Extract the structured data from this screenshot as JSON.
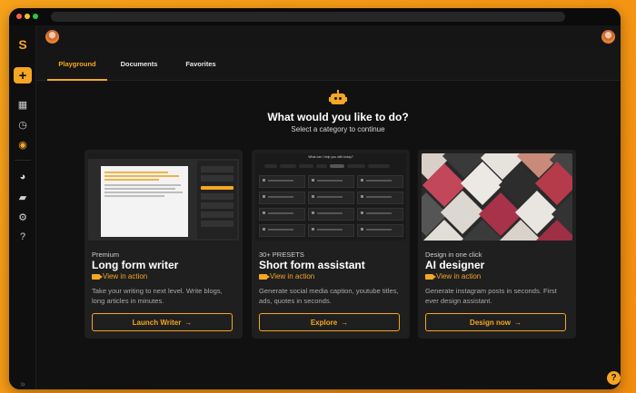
{
  "window": {
    "url_placeholder": ""
  },
  "sidebar": {
    "items": [
      {
        "icon": "logo-icon",
        "glyph": "S"
      },
      {
        "icon": "plus-icon",
        "glyph": "+"
      },
      {
        "icon": "grid-icon",
        "glyph": "▦"
      },
      {
        "icon": "clock-icon",
        "glyph": "◷"
      },
      {
        "icon": "eye-icon",
        "glyph": "◉"
      },
      {
        "icon": "palette-icon",
        "glyph": "◕"
      },
      {
        "icon": "folder-icon",
        "glyph": "▰"
      },
      {
        "icon": "gear-icon",
        "glyph": "⚙"
      },
      {
        "icon": "question-icon",
        "glyph": "?"
      },
      {
        "icon": "collapse-icon",
        "glyph": "»"
      }
    ]
  },
  "tabs": [
    {
      "label": "Playground",
      "active": true
    },
    {
      "label": "Documents",
      "active": false
    },
    {
      "label": "Favorites",
      "active": false
    }
  ],
  "main": {
    "heading": "What would you like to do?",
    "subheading": "Select a category to continue"
  },
  "cards": [
    {
      "eyebrow": "Premium",
      "title": "Long form writer",
      "link": "View in action",
      "desc": "Take your writing to next level. Write blogs, long articles in minutes.",
      "cta": "Launch Writer",
      "arrow": "→"
    },
    {
      "eyebrow": "30+ PRESETS",
      "title": "Short form assistant",
      "link": "View in action",
      "desc": "Generate social media caption, youtube titles, ads, quotes in seconds.",
      "cta": "Explore",
      "arrow": "→"
    },
    {
      "eyebrow": "Design in one click",
      "title": "AI designer",
      "link": "View in action",
      "desc": "Generate instagram posts in seconds. First ever design assistant.",
      "cta": "Design now",
      "arrow": "→"
    }
  ],
  "mini_grid_title": "What can I help you with today?",
  "help": {
    "glyph": "?"
  },
  "colors": {
    "accent": "#f5a623",
    "background": "#111111",
    "card": "#1f1f1f"
  }
}
